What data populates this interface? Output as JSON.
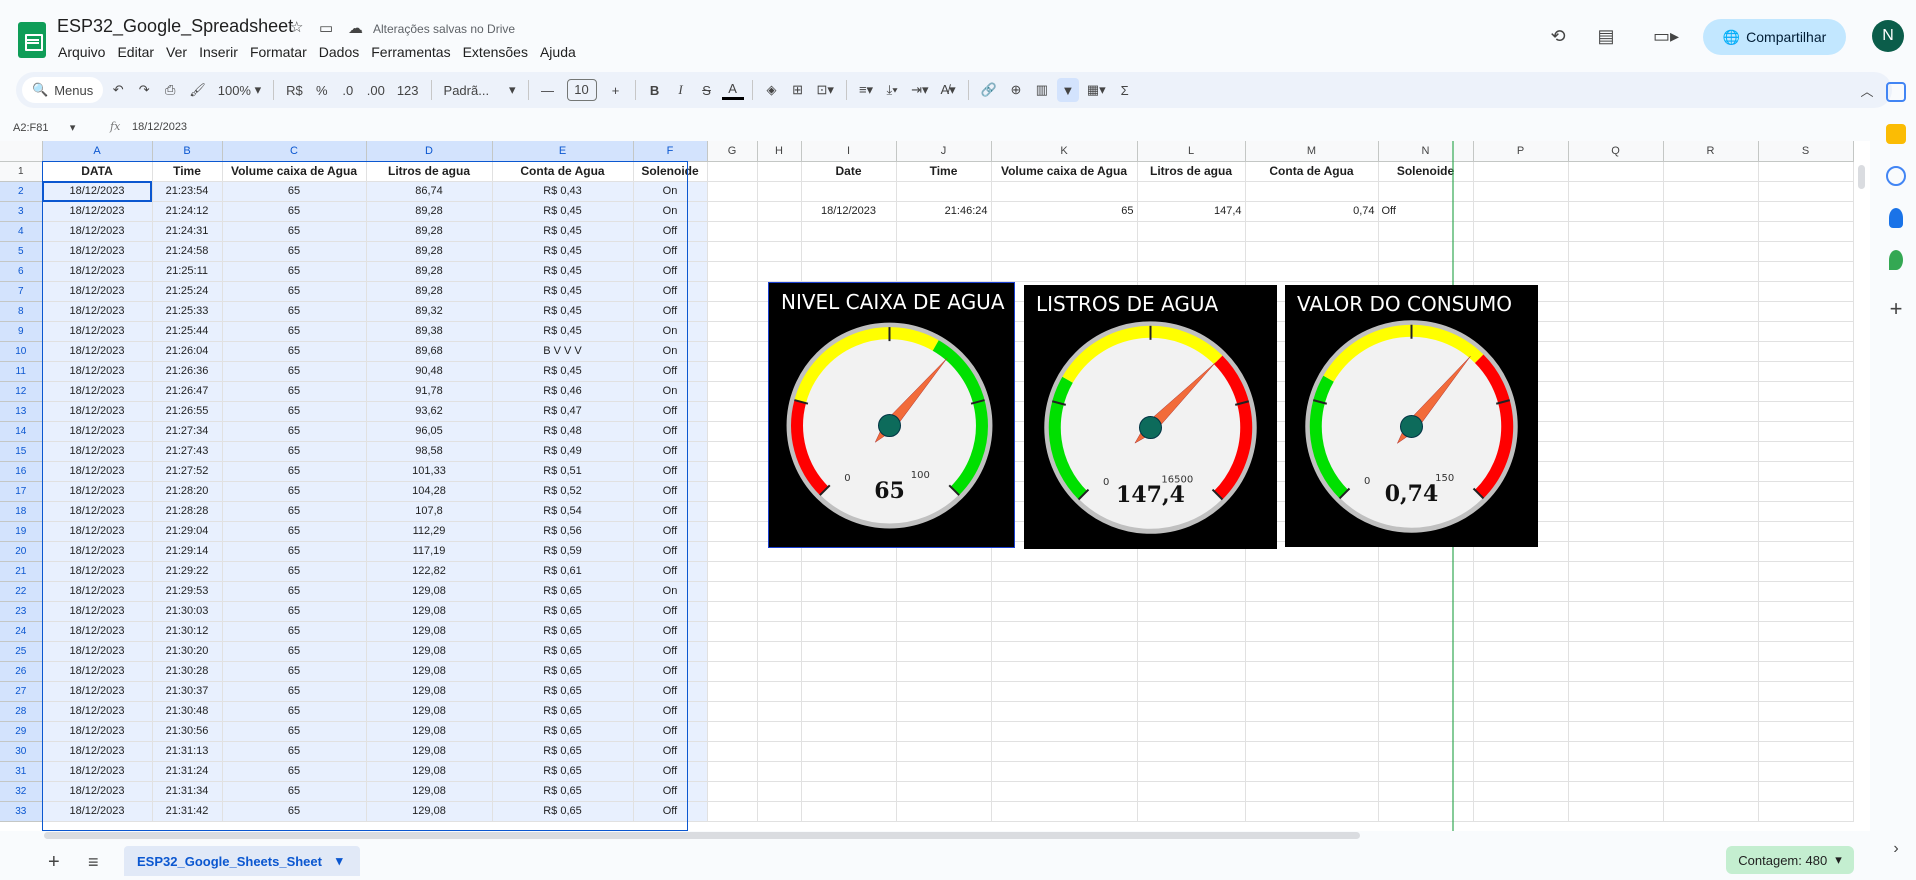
{
  "header": {
    "title": "ESP32_Google_Spreadsheet",
    "saved_status": "Alterações salvas no Drive",
    "share_label": "Compartilhar",
    "avatar_initial": "N",
    "icons": [
      "star-icon",
      "move-folder-icon",
      "cloud-saved-icon",
      "history-icon",
      "comments-icon",
      "meet-icon"
    ]
  },
  "menubar": [
    "Arquivo",
    "Editar",
    "Ver",
    "Inserir",
    "Formatar",
    "Dados",
    "Ferramentas",
    "Extensões",
    "Ajuda"
  ],
  "toolbar": {
    "menus_label": "Menus",
    "zoom": "100%",
    "currency": "R$",
    "percent": "%",
    "dec_less": ".0",
    "dec_more": ".00",
    "number_format": "123",
    "font": "Padrã...",
    "font_size": "10"
  },
  "formula_bar": {
    "range": "A2:F81",
    "value": "18/12/2023"
  },
  "columns": [
    "A",
    "B",
    "C",
    "D",
    "E",
    "F",
    "G",
    "H",
    "I",
    "J",
    "K",
    "L",
    "M",
    "N",
    "P",
    "Q",
    "R",
    "S"
  ],
  "headers_left": [
    "DATA",
    "Time",
    "Volume caixa de Agua",
    "Litros de agua",
    "Conta de Agua",
    "Solenoide"
  ],
  "headers_right": [
    "Date",
    "Time",
    "Volume caixa de Agua",
    "Litros de agua",
    "Conta de Agua",
    "Solenoide"
  ],
  "rows": [
    [
      "18/12/2023",
      "21:23:54",
      "65",
      "86,74",
      "R$ 0,43",
      "On"
    ],
    [
      "18/12/2023",
      "21:24:12",
      "65",
      "89,28",
      "R$ 0,45",
      "On"
    ],
    [
      "18/12/2023",
      "21:24:31",
      "65",
      "89,28",
      "R$ 0,45",
      "Off"
    ],
    [
      "18/12/2023",
      "21:24:58",
      "65",
      "89,28",
      "R$ 0,45",
      "Off"
    ],
    [
      "18/12/2023",
      "21:25:11",
      "65",
      "89,28",
      "R$ 0,45",
      "Off"
    ],
    [
      "18/12/2023",
      "21:25:24",
      "65",
      "89,28",
      "R$ 0,45",
      "Off"
    ],
    [
      "18/12/2023",
      "21:25:33",
      "65",
      "89,32",
      "R$ 0,45",
      "Off"
    ],
    [
      "18/12/2023",
      "21:25:44",
      "65",
      "89,38",
      "R$ 0,45",
      "On"
    ],
    [
      "18/12/2023",
      "21:26:04",
      "65",
      "89,68",
      "B V V V",
      "On"
    ],
    [
      "18/12/2023",
      "21:26:36",
      "65",
      "90,48",
      "R$ 0,45",
      "Off"
    ],
    [
      "18/12/2023",
      "21:26:47",
      "65",
      "91,78",
      "R$ 0,46",
      "On"
    ],
    [
      "18/12/2023",
      "21:26:55",
      "65",
      "93,62",
      "R$ 0,47",
      "Off"
    ],
    [
      "18/12/2023",
      "21:27:34",
      "65",
      "96,05",
      "R$ 0,48",
      "Off"
    ],
    [
      "18/12/2023",
      "21:27:43",
      "65",
      "98,58",
      "R$ 0,49",
      "Off"
    ],
    [
      "18/12/2023",
      "21:27:52",
      "65",
      "101,33",
      "R$ 0,51",
      "Off"
    ],
    [
      "18/12/2023",
      "21:28:20",
      "65",
      "104,28",
      "R$ 0,52",
      "Off"
    ],
    [
      "18/12/2023",
      "21:28:28",
      "65",
      "107,8",
      "R$ 0,54",
      "Off"
    ],
    [
      "18/12/2023",
      "21:29:04",
      "65",
      "112,29",
      "R$ 0,56",
      "Off"
    ],
    [
      "18/12/2023",
      "21:29:14",
      "65",
      "117,19",
      "R$ 0,59",
      "Off"
    ],
    [
      "18/12/2023",
      "21:29:22",
      "65",
      "122,82",
      "R$ 0,61",
      "Off"
    ],
    [
      "18/12/2023",
      "21:29:53",
      "65",
      "129,08",
      "R$ 0,65",
      "On"
    ],
    [
      "18/12/2023",
      "21:30:03",
      "65",
      "129,08",
      "R$ 0,65",
      "Off"
    ],
    [
      "18/12/2023",
      "21:30:12",
      "65",
      "129,08",
      "R$ 0,65",
      "Off"
    ],
    [
      "18/12/2023",
      "21:30:20",
      "65",
      "129,08",
      "R$ 0,65",
      "Off"
    ],
    [
      "18/12/2023",
      "21:30:28",
      "65",
      "129,08",
      "R$ 0,65",
      "Off"
    ],
    [
      "18/12/2023",
      "21:30:37",
      "65",
      "129,08",
      "R$ 0,65",
      "Off"
    ],
    [
      "18/12/2023",
      "21:30:48",
      "65",
      "129,08",
      "R$ 0,65",
      "Off"
    ],
    [
      "18/12/2023",
      "21:30:56",
      "65",
      "129,08",
      "R$ 0,65",
      "Off"
    ],
    [
      "18/12/2023",
      "21:31:13",
      "65",
      "129,08",
      "R$ 0,65",
      "Off"
    ],
    [
      "18/12/2023",
      "21:31:24",
      "65",
      "129,08",
      "R$ 0,65",
      "Off"
    ],
    [
      "18/12/2023",
      "21:31:34",
      "65",
      "129,08",
      "R$ 0,65",
      "Off"
    ],
    [
      "18/12/2023",
      "21:31:42",
      "65",
      "129,08",
      "R$ 0,65",
      "Off"
    ]
  ],
  "right_row": [
    "18/12/2023",
    "21:46:24",
    "65",
    "147,4",
    "0,74",
    "Off"
  ],
  "gauges": [
    {
      "title": "NIVEL CAIXA DE AGUA",
      "value": 65,
      "value_label": "65",
      "min": 0,
      "max": 100,
      "min_label": "0",
      "max_label": "100",
      "scheme": "red-yellow-green"
    },
    {
      "title": "LISTROS DE AGUA",
      "value": 147.4,
      "value_label": "147,4",
      "min": 0,
      "max": 16500,
      "min_label": "0",
      "max_label": "16500",
      "scheme": "green-yellow-red"
    },
    {
      "title": "VALOR DO CONSUMO",
      "value": 0.74,
      "value_label": "0,74",
      "min": 0,
      "max": 150,
      "min_label": "0",
      "max_label": "150",
      "scheme": "green-yellow-red"
    }
  ],
  "bottom": {
    "sheet_name": "ESP32_Google_Sheets_Sheet",
    "count_label": "Contagem: 480"
  },
  "colors": {
    "accent": "#0b57d0",
    "share_bg": "#c2e7ff",
    "selection": "#e8f0fe",
    "count_bg": "#c4eed0"
  }
}
